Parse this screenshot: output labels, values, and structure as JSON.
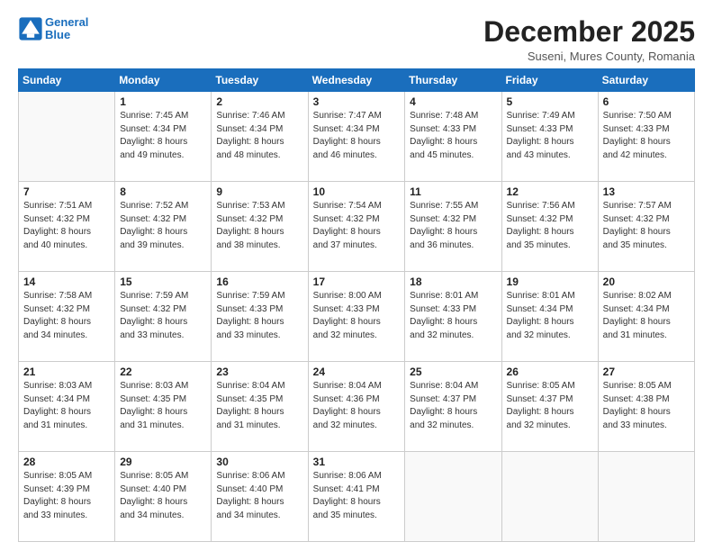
{
  "logo": {
    "line1": "General",
    "line2": "Blue"
  },
  "title": "December 2025",
  "subtitle": "Suseni, Mures County, Romania",
  "days_of_week": [
    "Sunday",
    "Monday",
    "Tuesday",
    "Wednesday",
    "Thursday",
    "Friday",
    "Saturday"
  ],
  "weeks": [
    [
      {
        "day": "",
        "info": ""
      },
      {
        "day": "1",
        "info": "Sunrise: 7:45 AM\nSunset: 4:34 PM\nDaylight: 8 hours\nand 49 minutes."
      },
      {
        "day": "2",
        "info": "Sunrise: 7:46 AM\nSunset: 4:34 PM\nDaylight: 8 hours\nand 48 minutes."
      },
      {
        "day": "3",
        "info": "Sunrise: 7:47 AM\nSunset: 4:34 PM\nDaylight: 8 hours\nand 46 minutes."
      },
      {
        "day": "4",
        "info": "Sunrise: 7:48 AM\nSunset: 4:33 PM\nDaylight: 8 hours\nand 45 minutes."
      },
      {
        "day": "5",
        "info": "Sunrise: 7:49 AM\nSunset: 4:33 PM\nDaylight: 8 hours\nand 43 minutes."
      },
      {
        "day": "6",
        "info": "Sunrise: 7:50 AM\nSunset: 4:33 PM\nDaylight: 8 hours\nand 42 minutes."
      }
    ],
    [
      {
        "day": "7",
        "info": "Sunrise: 7:51 AM\nSunset: 4:32 PM\nDaylight: 8 hours\nand 40 minutes."
      },
      {
        "day": "8",
        "info": "Sunrise: 7:52 AM\nSunset: 4:32 PM\nDaylight: 8 hours\nand 39 minutes."
      },
      {
        "day": "9",
        "info": "Sunrise: 7:53 AM\nSunset: 4:32 PM\nDaylight: 8 hours\nand 38 minutes."
      },
      {
        "day": "10",
        "info": "Sunrise: 7:54 AM\nSunset: 4:32 PM\nDaylight: 8 hours\nand 37 minutes."
      },
      {
        "day": "11",
        "info": "Sunrise: 7:55 AM\nSunset: 4:32 PM\nDaylight: 8 hours\nand 36 minutes."
      },
      {
        "day": "12",
        "info": "Sunrise: 7:56 AM\nSunset: 4:32 PM\nDaylight: 8 hours\nand 35 minutes."
      },
      {
        "day": "13",
        "info": "Sunrise: 7:57 AM\nSunset: 4:32 PM\nDaylight: 8 hours\nand 35 minutes."
      }
    ],
    [
      {
        "day": "14",
        "info": "Sunrise: 7:58 AM\nSunset: 4:32 PM\nDaylight: 8 hours\nand 34 minutes."
      },
      {
        "day": "15",
        "info": "Sunrise: 7:59 AM\nSunset: 4:32 PM\nDaylight: 8 hours\nand 33 minutes."
      },
      {
        "day": "16",
        "info": "Sunrise: 7:59 AM\nSunset: 4:33 PM\nDaylight: 8 hours\nand 33 minutes."
      },
      {
        "day": "17",
        "info": "Sunrise: 8:00 AM\nSunset: 4:33 PM\nDaylight: 8 hours\nand 32 minutes."
      },
      {
        "day": "18",
        "info": "Sunrise: 8:01 AM\nSunset: 4:33 PM\nDaylight: 8 hours\nand 32 minutes."
      },
      {
        "day": "19",
        "info": "Sunrise: 8:01 AM\nSunset: 4:34 PM\nDaylight: 8 hours\nand 32 minutes."
      },
      {
        "day": "20",
        "info": "Sunrise: 8:02 AM\nSunset: 4:34 PM\nDaylight: 8 hours\nand 31 minutes."
      }
    ],
    [
      {
        "day": "21",
        "info": "Sunrise: 8:03 AM\nSunset: 4:34 PM\nDaylight: 8 hours\nand 31 minutes."
      },
      {
        "day": "22",
        "info": "Sunrise: 8:03 AM\nSunset: 4:35 PM\nDaylight: 8 hours\nand 31 minutes."
      },
      {
        "day": "23",
        "info": "Sunrise: 8:04 AM\nSunset: 4:35 PM\nDaylight: 8 hours\nand 31 minutes."
      },
      {
        "day": "24",
        "info": "Sunrise: 8:04 AM\nSunset: 4:36 PM\nDaylight: 8 hours\nand 32 minutes."
      },
      {
        "day": "25",
        "info": "Sunrise: 8:04 AM\nSunset: 4:37 PM\nDaylight: 8 hours\nand 32 minutes."
      },
      {
        "day": "26",
        "info": "Sunrise: 8:05 AM\nSunset: 4:37 PM\nDaylight: 8 hours\nand 32 minutes."
      },
      {
        "day": "27",
        "info": "Sunrise: 8:05 AM\nSunset: 4:38 PM\nDaylight: 8 hours\nand 33 minutes."
      }
    ],
    [
      {
        "day": "28",
        "info": "Sunrise: 8:05 AM\nSunset: 4:39 PM\nDaylight: 8 hours\nand 33 minutes."
      },
      {
        "day": "29",
        "info": "Sunrise: 8:05 AM\nSunset: 4:40 PM\nDaylight: 8 hours\nand 34 minutes."
      },
      {
        "day": "30",
        "info": "Sunrise: 8:06 AM\nSunset: 4:40 PM\nDaylight: 8 hours\nand 34 minutes."
      },
      {
        "day": "31",
        "info": "Sunrise: 8:06 AM\nSunset: 4:41 PM\nDaylight: 8 hours\nand 35 minutes."
      },
      {
        "day": "",
        "info": ""
      },
      {
        "day": "",
        "info": ""
      },
      {
        "day": "",
        "info": ""
      }
    ]
  ]
}
